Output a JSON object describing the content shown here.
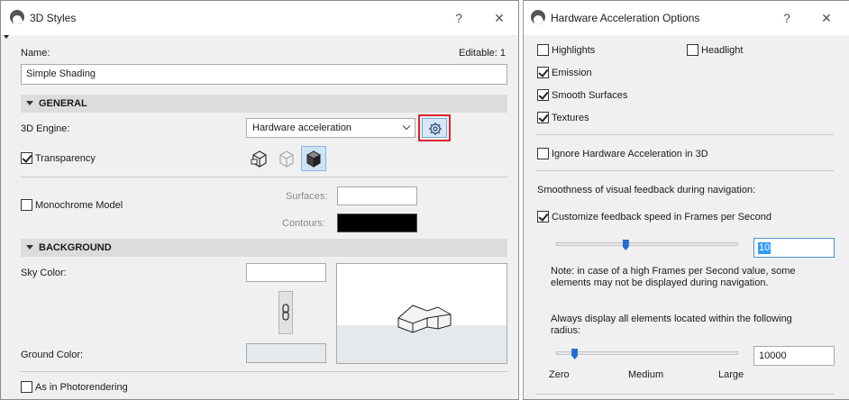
{
  "styles_dialog": {
    "title": "3D Styles",
    "help": "?",
    "close": "✕",
    "name_label": "Name:",
    "editable_label": "Editable: 1",
    "name_value": "Simple Shading",
    "general_section": "GENERAL",
    "engine_label": "3D Engine:",
    "engine_value": "Hardware acceleration",
    "transparency_label": "Transparency",
    "transparency_checked": true,
    "monochrome_label": "Monochrome Model",
    "monochrome_checked": false,
    "surfaces_label": "Surfaces:",
    "contours_label": "Contours:",
    "contours_color": "#000000",
    "surfaces_color": "#ffffff",
    "background_section": "BACKGROUND",
    "sky_color_label": "Sky Color:",
    "ground_color_label": "Ground Color:",
    "ground_color": "#e6e9ec",
    "photorendering_label": "As in Photorendering",
    "photorendering_checked": false,
    "settings_highlight_color": "#d9232d"
  },
  "hw_dialog": {
    "title": "Hardware Acceleration Options",
    "help": "?",
    "close": "✕",
    "highlights_label": "Highlights",
    "highlights_checked": false,
    "headlight_label": "Headlight",
    "headlight_checked": false,
    "emission_label": "Emission",
    "emission_checked": true,
    "smooth_label": "Smooth Surfaces",
    "smooth_checked": true,
    "textures_label": "Textures",
    "textures_checked": true,
    "ignore_label": "Ignore Hardware Acceleration in 3D",
    "ignore_checked": false,
    "smoothness_heading": "Smoothness of visual feedback during navigation:",
    "customize_label": "Customize feedback speed in Frames per Second",
    "customize_checked": true,
    "fps_value": "10",
    "fps_slider_fraction": 0.38,
    "note_line1": "Note: in case of a high Frames per Second value, some",
    "note_line2": "elements may not be displayed during navigation.",
    "radius_line1": "Always display all elements located within the following",
    "radius_line2": "radius:",
    "radius_value": "10000",
    "radius_slider_fraction": 0.1,
    "scale_zero": "Zero",
    "scale_medium": "Medium",
    "scale_large": "Large"
  }
}
